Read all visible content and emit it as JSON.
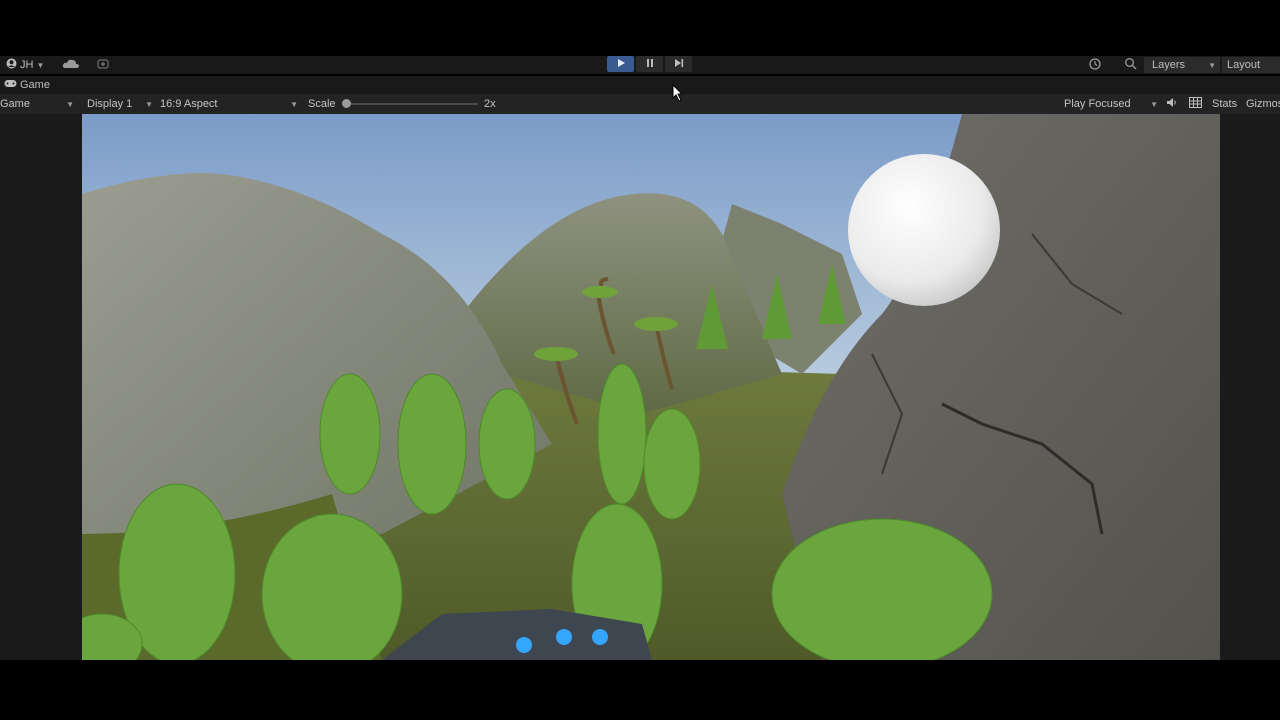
{
  "toolbar": {
    "account_label": "JH",
    "layers_label": "Layers",
    "layout_label": "Layout"
  },
  "tab": {
    "label": "Game"
  },
  "controls": {
    "game_select": "Game",
    "display_select": "Display 1",
    "aspect_select": "16:9 Aspect",
    "scale_label": "Scale",
    "scale_value": "2x",
    "play_mode_select": "Play Focused",
    "stats_label": "Stats",
    "gizmos_label": "Gizmos"
  },
  "icons": {
    "account": "user-icon",
    "cloud": "cloud-icon",
    "collab": "collab-icon",
    "play": "play-icon",
    "pause": "pause-icon",
    "step": "step-icon",
    "history": "history-icon",
    "search": "search-icon",
    "gamepad": "gamepad-icon",
    "audio": "speaker-icon",
    "grid": "grid-icon"
  },
  "colors": {
    "play_active": "#3a5b8f",
    "panel_bg": "#232323",
    "toolbar_bg": "#191919"
  }
}
